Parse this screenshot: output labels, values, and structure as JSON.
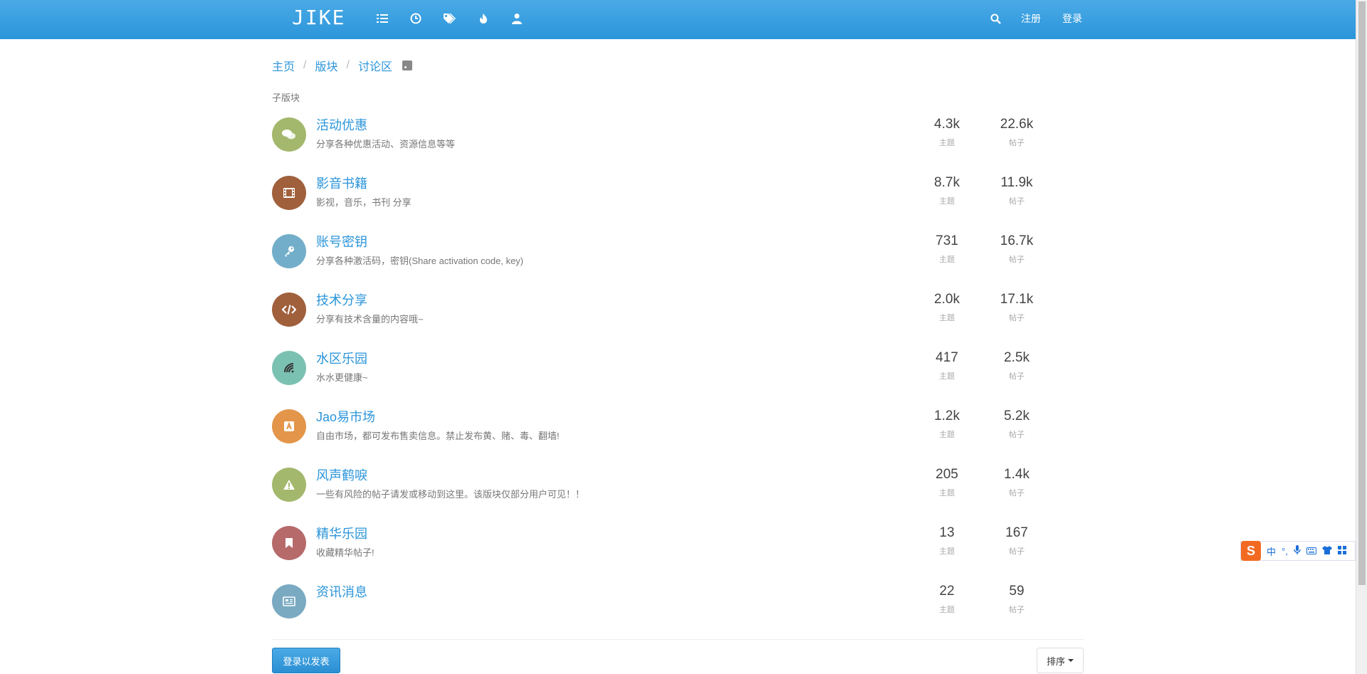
{
  "header": {
    "brand": "JIKE",
    "nav_icons": [
      "list-icon",
      "clock-icon",
      "tags-icon",
      "fire-icon",
      "user-icon"
    ],
    "search_icon": "search-icon",
    "register_label": "注册",
    "login_label": "登录"
  },
  "breadcrumb": {
    "home": "主页",
    "categories": "版块",
    "current": "讨论区"
  },
  "section_label": "子版块",
  "categories": [
    {
      "title": "活动优惠",
      "desc": "分享各种优惠活动、资源信息等等",
      "topics": "4.3k",
      "posts": "22.6k",
      "icon": "comments-icon",
      "color": "#a3b86c"
    },
    {
      "title": "影音书籍",
      "desc": "影视，音乐，书刊 分享",
      "topics": "8.7k",
      "posts": "11.9k",
      "icon": "film-icon",
      "color": "#a0603c"
    },
    {
      "title": "账号密钥",
      "desc": "分享各种激活码，密钥(Share activation code, key)",
      "topics": "731",
      "posts": "16.7k",
      "icon": "key-icon",
      "color": "#72aec9"
    },
    {
      "title": "技术分享",
      "desc": "分享有技术含量的内容哦~",
      "topics": "2.0k",
      "posts": "17.1k",
      "icon": "code-icon",
      "color": "#a0603c"
    },
    {
      "title": "水区乐园",
      "desc": "水水更健康~",
      "topics": "417",
      "posts": "2.5k",
      "icon": "signal-icon",
      "color": "#7bc1b2"
    },
    {
      "title": "Jao易市场",
      "desc": "自由市场，都可发布售卖信息。禁止发布黄、赌、毒、翻墙!",
      "topics": "1.2k",
      "posts": "5.2k",
      "icon": "market-icon",
      "color": "#e39549"
    },
    {
      "title": "风声鹤唳",
      "desc": "一些有风险的帖子请发或移动到这里。该版块仅部分用户可见！！",
      "topics": "205",
      "posts": "1.4k",
      "icon": "warning-icon",
      "color": "#a3b86c"
    },
    {
      "title": "精华乐园",
      "desc": "收藏精华帖子!",
      "topics": "13",
      "posts": "167",
      "icon": "bookmark-icon",
      "color": "#b66a6a"
    },
    {
      "title": "资讯消息",
      "desc": "",
      "topics": "22",
      "posts": "59",
      "icon": "newspaper-icon",
      "color": "#7aaac2"
    }
  ],
  "labels": {
    "topics": "主题",
    "posts": "帖子"
  },
  "footer": {
    "login_to_post": "登录以发表",
    "sort": "排序"
  },
  "ime": {
    "mode": "中",
    "punct": "°,"
  }
}
